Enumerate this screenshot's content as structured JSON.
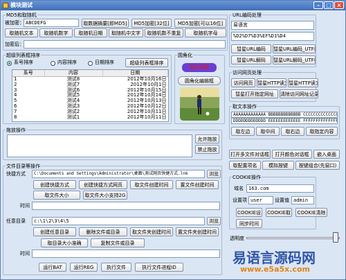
{
  "window": {
    "title": "模块测试"
  },
  "random": {
    "title": "MD5和取随机",
    "addressee_label": "被加密：",
    "addressee_value": "ABCDEFG",
    "btn_abstract": "取数据摘要[即MD5]",
    "btn_md5_32": "MD5加密[32位]",
    "btn_md5_16": "MD5加密[可以16位]",
    "row2": [
      "取随机文本",
      "取随机数字",
      "取随机日期",
      "取随机中文字",
      "取随机数不重复",
      "取随机字母"
    ],
    "after_label": "加密后："
  },
  "url": {
    "title": "URL编码处理",
    "val1": "易语言",
    "val2": "%D2%D7%D3%EF%D1%D4",
    "btns": [
      "彗星URL编码",
      "彗星URL编码_UTF8",
      "彗星URL解码",
      "彗星URL解码_UTF8"
    ]
  },
  "sort": {
    "title": "超级列表框排序",
    "radios": [
      "系号排序",
      "内容排序",
      "日期排序"
    ],
    "sort_btn": "超级列表框排序",
    "columns": [
      "系号",
      "内容",
      "日期"
    ],
    "rows": [
      [
        "1",
        "测试8",
        "2012年10月16日"
      ],
      [
        "2",
        "测试7",
        "2012年10月1日"
      ],
      [
        "3",
        "测试6",
        "2012年10月15日"
      ],
      [
        "4",
        "测试5",
        "2012年10月14日"
      ],
      [
        "5",
        "测试4",
        "2012年10月13日"
      ],
      [
        "6",
        "测试3",
        "2012年10月12日"
      ],
      [
        "7",
        "测试2",
        "2012年10月11日"
      ],
      [
        "8",
        "测试1",
        "2012年10月11日"
      ]
    ]
  },
  "rounded": {
    "title": "圆角化",
    "badge": "图片圆角",
    "btn": "圆角化编辑框"
  },
  "webpage": {
    "title": "访问网页处理",
    "btns": [
      "访问网页",
      "彗星HTTP读文本",
      "彗星HTTP读文件",
      "彗星打开指定网址",
      "清除访问网址记录"
    ]
  },
  "text": {
    "title": "取文本操作",
    "val1": "AAAAAAAAAAAAA BBBBBBBBBBBBB CCCCCCCCCCCCCCC",
    "val2": "DDDDDDDDDDDDD EEEEEEEEEEEEE FFFFFFFFFFFFFFF",
    "btns": [
      "取左边",
      "取中间",
      "取右边",
      "取指定内容"
    ]
  },
  "drag": {
    "title": "拖放操作",
    "allow": "允许拖放",
    "forbid": "禁止拖放"
  },
  "misc": {
    "btns": [
      "打开多文件对话框",
      "打开颜色对话框",
      "嵌入桌面",
      "取配置项名",
      "模拟按键",
      "按键组合(先窗口)"
    ]
  },
  "cookie": {
    "title": "COOKIE操作",
    "domain_label": "域名",
    "domain_value": "163.com",
    "key_label": "设置项",
    "key_value": "user",
    "val_label": "设置值",
    "val_value": "admin",
    "btns": [
      "COOKIE设",
      "COOKIE取",
      "COOKIE清除"
    ],
    "sync": "同步时间"
  },
  "opacity": {
    "label": "透明度"
  },
  "files": {
    "title": "文件目录等操作",
    "shortcut_label": "快捷方式",
    "shortcut_value": "C:\\Documents and Settings\\Administrator\\桌面\\测试网页快捷方式.lnk",
    "browse": "浏览",
    "row1": [
      "创建快捷方式",
      "创建快捷方式网页",
      "取文件创建时间",
      "置文件创建时间"
    ],
    "row2": [
      "取文件大小",
      "取文件大小支持2G"
    ],
    "time_label": "时间",
    "dir_label": "任意目录",
    "dir_value": "c:\\1\\2\\3\\4\\5",
    "row3": [
      "创建任意目录",
      "删除文件或目录",
      "取文件夹创建时间",
      "置文件夹创建时间"
    ],
    "row4": [
      "取目录大小准确",
      "复制文件或目录"
    ],
    "row5": [
      "运行BAT",
      "运行REG",
      "执行文件",
      "执行文件进程ID"
    ]
  },
  "watermark": {
    "cn": "易语言源码网",
    "url": "www.e5a5x.com"
  }
}
